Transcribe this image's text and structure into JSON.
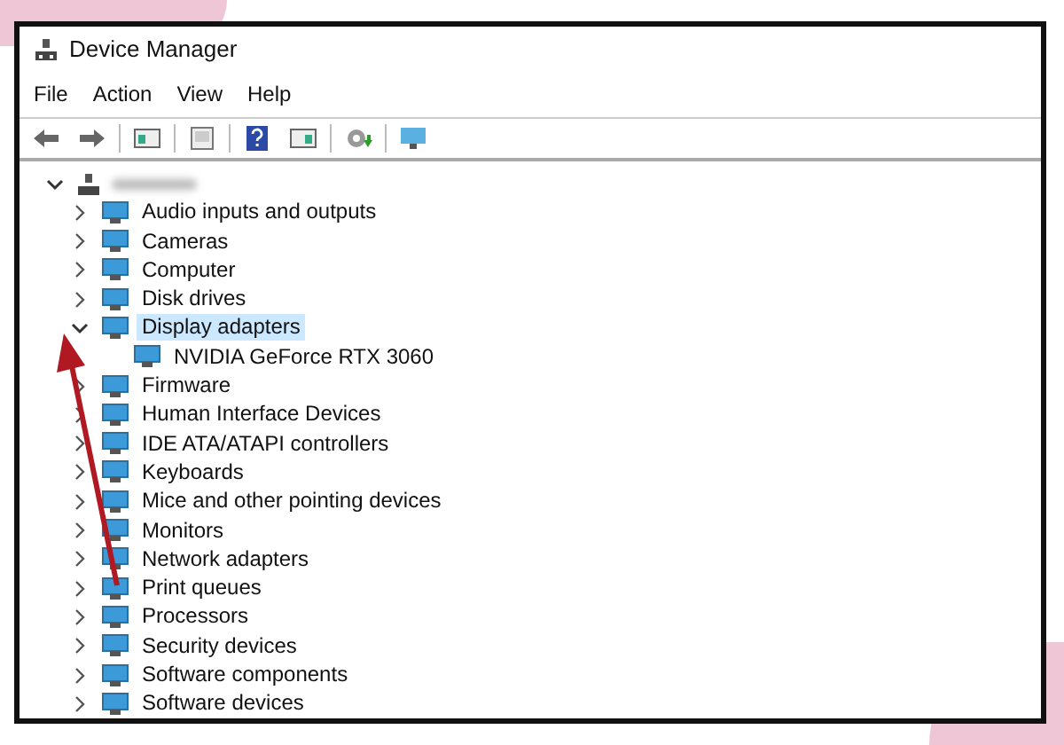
{
  "window": {
    "title": "Device Manager"
  },
  "menu": [
    "File",
    "Action",
    "View",
    "Help"
  ],
  "tree": {
    "expanded": true,
    "children": [
      {
        "label": "Audio inputs and outputs",
        "expanded": false,
        "selected": false
      },
      {
        "label": "Cameras",
        "expanded": false,
        "selected": false
      },
      {
        "label": "Computer",
        "expanded": false,
        "selected": false
      },
      {
        "label": "Disk drives",
        "expanded": false,
        "selected": false
      },
      {
        "label": "Display adapters",
        "expanded": true,
        "selected": true,
        "children": [
          {
            "label": "NVIDIA GeForce RTX 3060",
            "selected": false
          }
        ]
      },
      {
        "label": "Firmware",
        "expanded": false,
        "selected": false
      },
      {
        "label": "Human Interface Devices",
        "expanded": false,
        "selected": false
      },
      {
        "label": "IDE ATA/ATAPI controllers",
        "expanded": false,
        "selected": false
      },
      {
        "label": "Keyboards",
        "expanded": false,
        "selected": false
      },
      {
        "label": "Mice and other pointing devices",
        "expanded": false,
        "selected": false
      },
      {
        "label": "Monitors",
        "expanded": false,
        "selected": false
      },
      {
        "label": "Network adapters",
        "expanded": false,
        "selected": false
      },
      {
        "label": "Print queues",
        "expanded": false,
        "selected": false
      },
      {
        "label": "Processors",
        "expanded": false,
        "selected": false
      },
      {
        "label": "Security devices",
        "expanded": false,
        "selected": false
      },
      {
        "label": "Software components",
        "expanded": false,
        "selected": false
      },
      {
        "label": "Software devices",
        "expanded": false,
        "selected": false
      }
    ]
  }
}
